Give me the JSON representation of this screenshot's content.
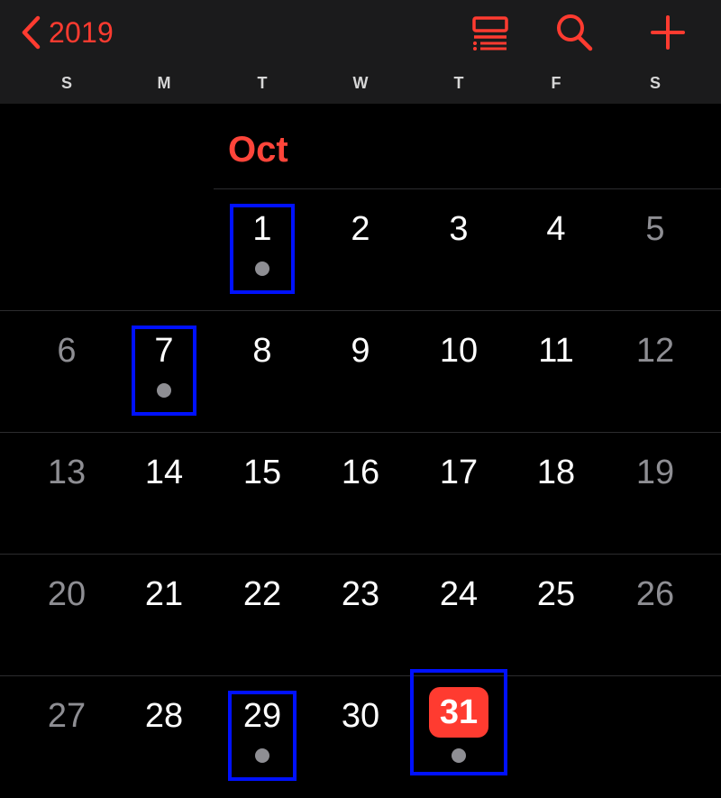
{
  "header": {
    "back_label": "2019",
    "accent_color": "#ff3b30",
    "actions": [
      {
        "name": "list-view-icon"
      },
      {
        "name": "search-icon"
      },
      {
        "name": "add-icon"
      }
    ]
  },
  "weekdays": [
    "S",
    "M",
    "T",
    "W",
    "T",
    "F",
    "S"
  ],
  "calendar": {
    "month_label": "Oct",
    "today": "31",
    "weeks": [
      [
        "",
        "",
        "1",
        "2",
        "3",
        "4",
        "5"
      ],
      [
        "6",
        "7",
        "8",
        "9",
        "10",
        "11",
        "12"
      ],
      [
        "13",
        "14",
        "15",
        "16",
        "17",
        "18",
        "19"
      ],
      [
        "20",
        "21",
        "22",
        "23",
        "24",
        "25",
        "26"
      ],
      [
        "27",
        "28",
        "29",
        "30",
        "31",
        "",
        ""
      ]
    ],
    "days_with_events": [
      "1",
      "7",
      "29",
      "31"
    ],
    "highlighted_days": [
      "1",
      "7",
      "29",
      "31"
    ],
    "highlight_color": "#0011ff"
  }
}
